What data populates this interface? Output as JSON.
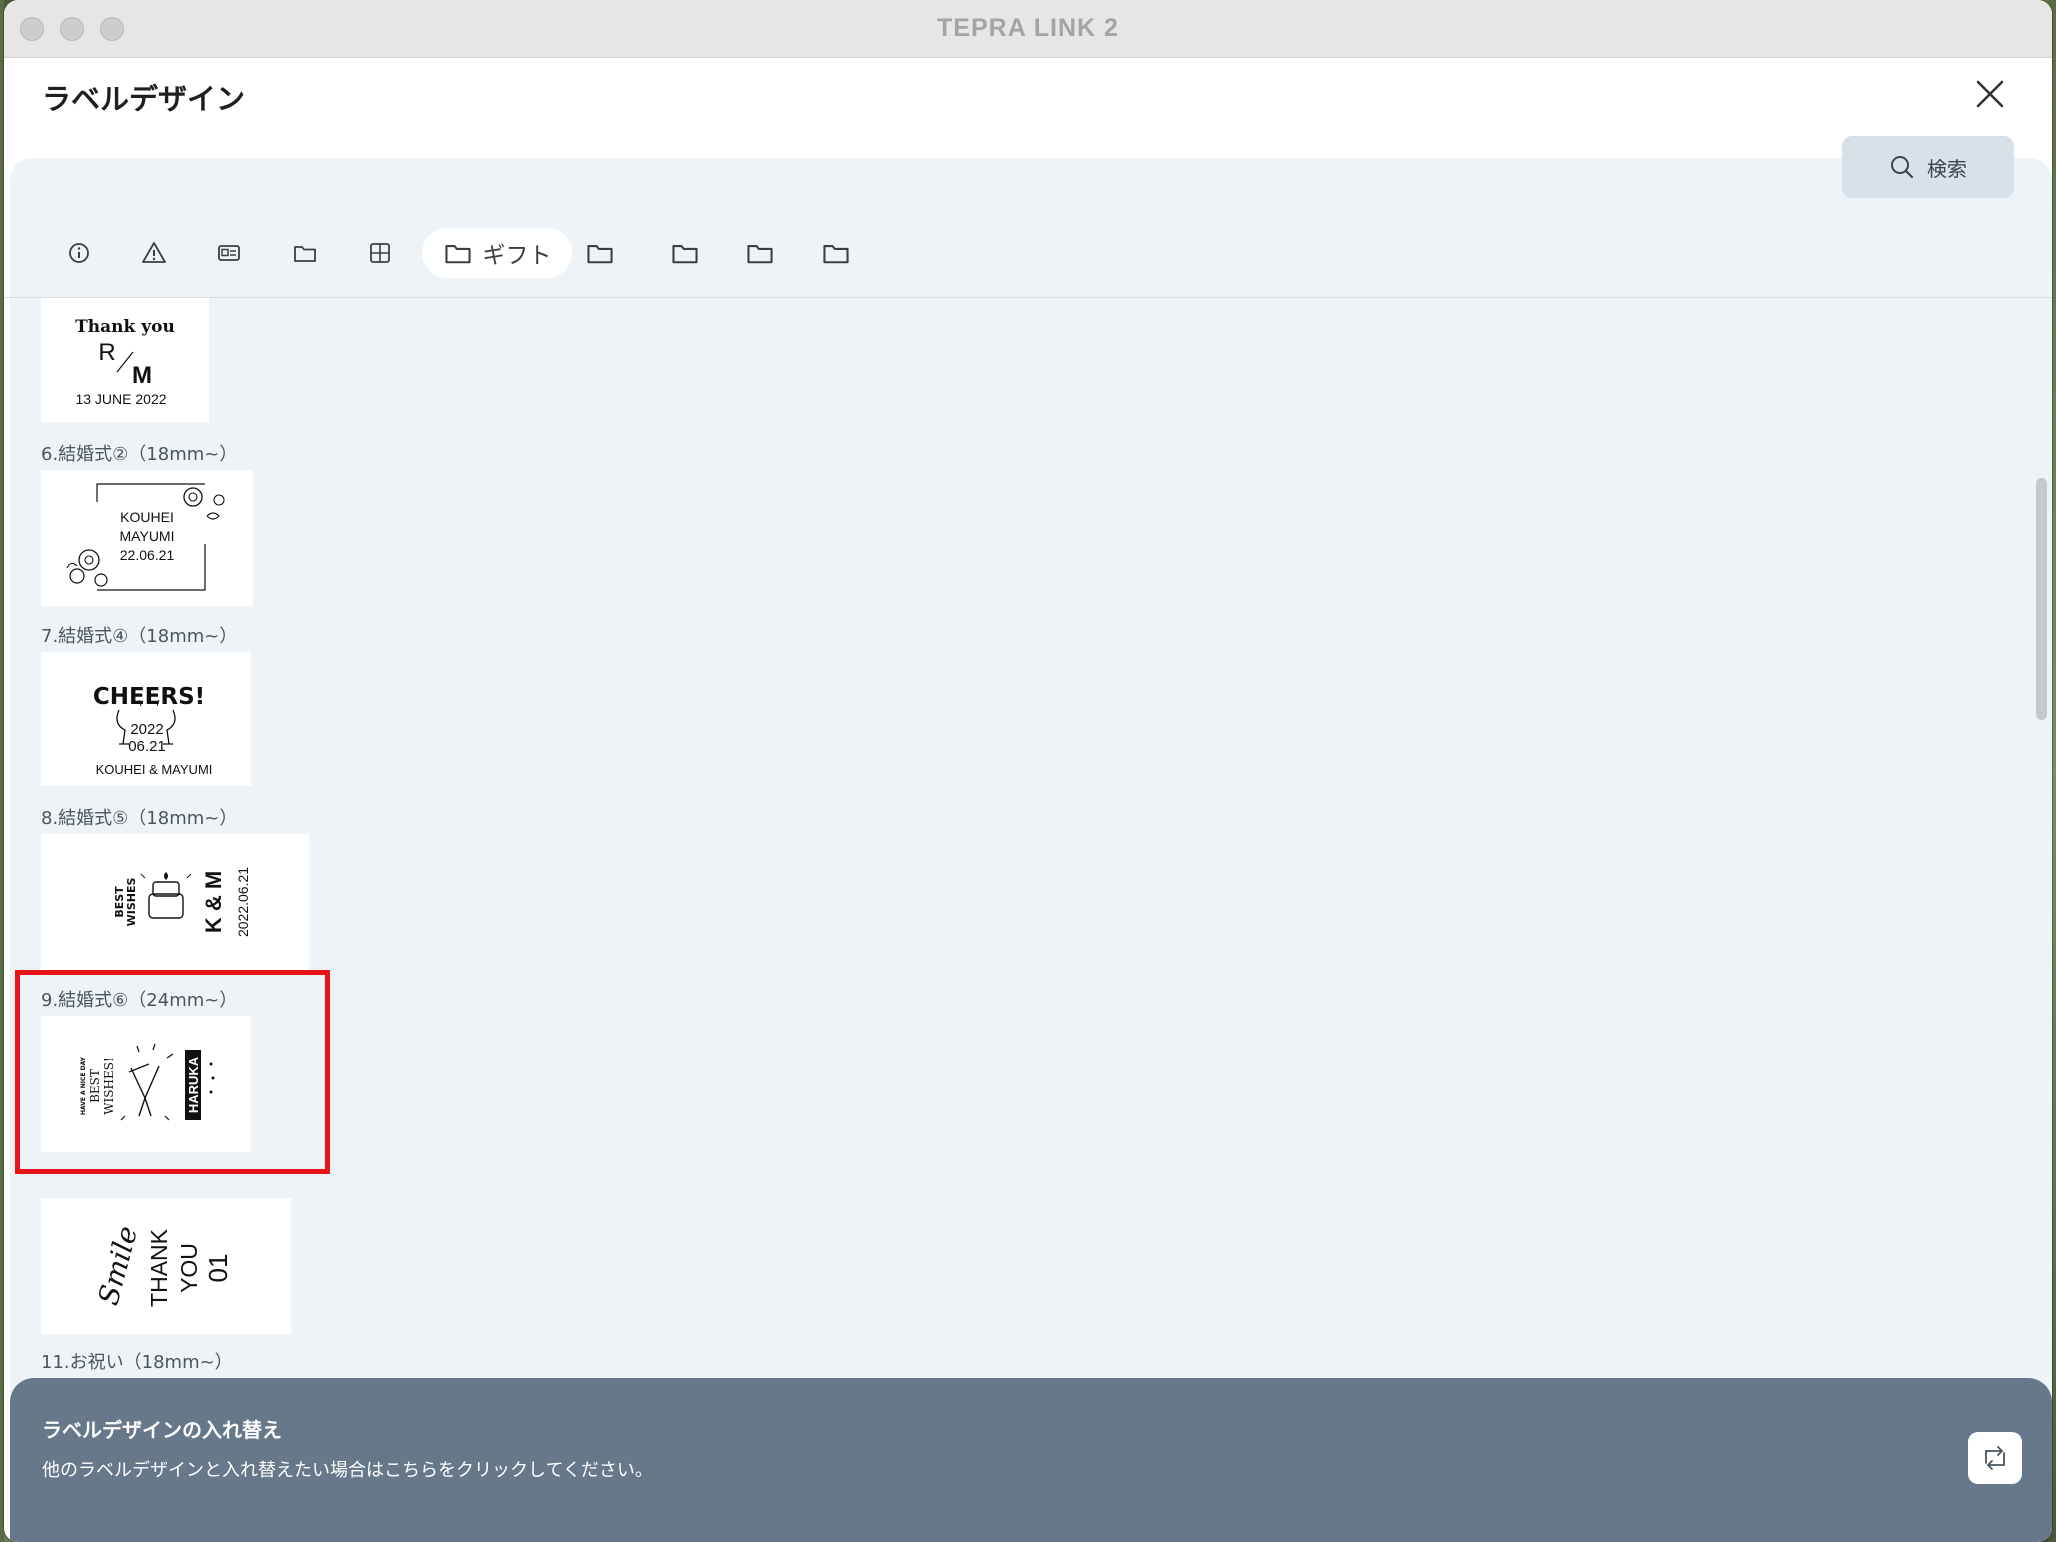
{
  "window": {
    "title": "TEPRA LINK 2"
  },
  "header": {
    "title": "ラベルデザイン"
  },
  "search": {
    "label": "検索"
  },
  "tabs": {
    "active_label": "ギフト"
  },
  "sections": [
    {
      "label": "6.結婚式②（18mm~）"
    },
    {
      "label": "7.結婚式④（18mm~）"
    },
    {
      "label": "8.結婚式⑤（18mm~）"
    },
    {
      "label": "9.結婚式⑥（24mm~）"
    },
    {
      "label": "11.お祝い（18mm~）"
    }
  ],
  "cards": {
    "c5": {
      "line1": "Thank you",
      "r": "R",
      "m": "M",
      "date": "13 JUNE 2022"
    },
    "c6": {
      "name1": "KOUHEI",
      "name2": "MAYUMI",
      "date": "22.06.21"
    },
    "c7": {
      "title": "CHEERS!",
      "year": "2022",
      "date": "06.21",
      "names": "KOUHEI & MAYUMI"
    },
    "c8": {
      "best": "BEST",
      "wishes": "WISHES",
      "initials": "K & M",
      "date": "2022.06.21"
    },
    "c9": {
      "tiny": "HAVE A NICE DAY",
      "best": "BEST",
      "wishes": "WISHES!",
      "name": "HARUKA"
    },
    "c10": {
      "smile": "Smile",
      "thank": "THANK",
      "you": "YOU",
      "num": "01"
    }
  },
  "banner": {
    "title": "ラベルデザインの入れ替え",
    "description": "他のラベルデザインと入れ替えたい場合はこちらをクリックしてください。"
  },
  "colors": {
    "highlight": "#e8141a",
    "banner": "#67788a",
    "panel": "#eef3f8"
  }
}
